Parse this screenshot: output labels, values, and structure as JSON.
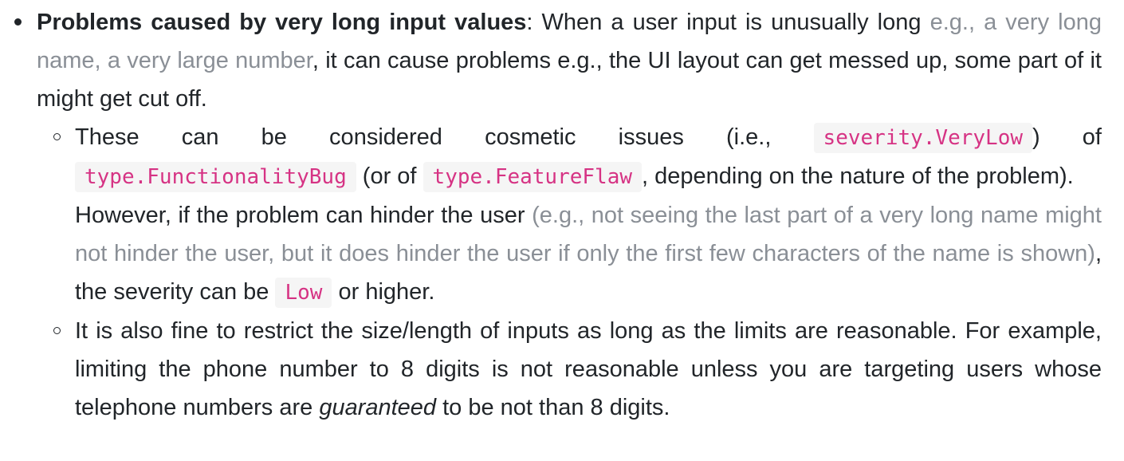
{
  "outer_item": {
    "heading": "Problems caused by very long input values",
    "sep": ":",
    "text_1": " When a user input is unusually long ",
    "example": "e.g., a very long name, a very large number",
    "text_2": ", it can cause problems e.g., the UI layout can get messed up, some part of it might get cut off."
  },
  "sub_item_1": {
    "text_1": "These can be considered cosmetic issues (i.e., ",
    "code_severity": "severity.VeryLow",
    "text_2": ") of ",
    "code_functionality": "type.FunctionalityBug",
    "text_3": " (or of ",
    "code_feature": "type.FeatureFlaw",
    "text_4": ", depending on the nature of the problem).",
    "para2_text_1": "However, if the problem can hinder the user ",
    "para2_example": "(e.g., not seeing the last part of a very long name might not hinder the user, but it does hinder the user if only the first few characters of the name is shown)",
    "para2_text_2": ", the severity can be ",
    "code_low": "Low",
    "para2_text_3": " or higher."
  },
  "sub_item_2": {
    "text_1": "It is also fine to restrict the size/length of inputs as long as the limits are reasonable. For example, limiting the phone number to 8 digits is not reasonable unless you are targeting users whose telephone numbers are ",
    "emphasis": "guaranteed",
    "text_2": " to be not than 8 digits."
  }
}
